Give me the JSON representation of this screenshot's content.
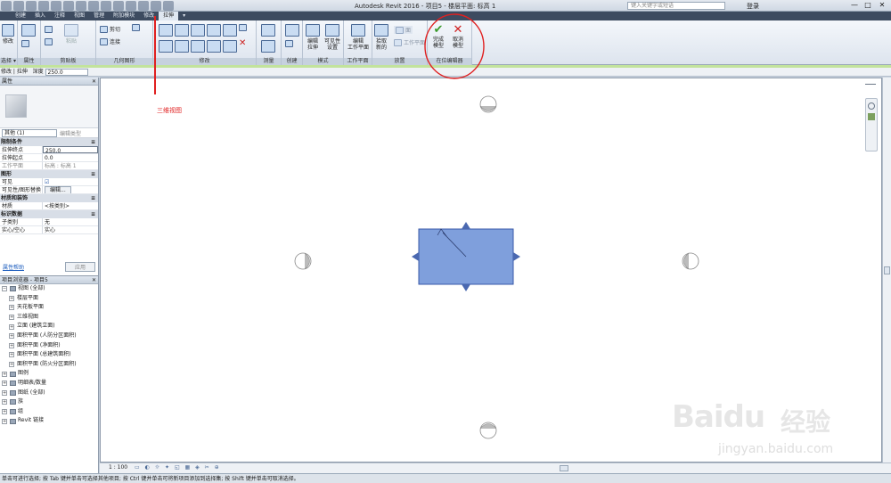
{
  "titlebar": {
    "title": "Autodesk Revit 2016 - 项目5 - 楼层平面: 标高 1",
    "search_placeholder": "键入关键字或短语",
    "login": "登录",
    "min": "—",
    "max": "□",
    "close": "✕"
  },
  "tabs": [
    "创建",
    "插入",
    "注释",
    "视图",
    "管理",
    "附加模块",
    "修改",
    "拉伸",
    "▾"
  ],
  "ribbon": {
    "modify_label": "修改",
    "select_label": "选择 ▾",
    "properties_label": "属性",
    "clipboard": {
      "paste": "粘贴",
      "label": "剪贴板"
    },
    "geometry": {
      "cut": "剪切",
      "join": "连接",
      "label": "几何图形"
    },
    "modify_panel_label": "修改",
    "measure_label": "测量",
    "create_label": "创建",
    "mode": {
      "edit_extrusion": "编辑\n拉伸",
      "visibility": "可见性\n设置",
      "label": "模式"
    },
    "workplane": {
      "edit": "编辑\n工作平面",
      "label": "工作平面"
    },
    "place": {
      "pick_new": "拾取\n新的",
      "face": "面",
      "workplane_btn": "工作平面",
      "label": "放置"
    },
    "inplace": {
      "finish": "完成\n模型",
      "cancel": "取消\n模型",
      "label": "在位编辑器"
    }
  },
  "optbar": {
    "context": "修改 | 拉伸",
    "depth_label": "深度",
    "depth_value": "250.0"
  },
  "properties": {
    "header": "属性",
    "type_selector": "其他 (1)",
    "edit_type": "编辑类型",
    "categories": {
      "constraints": "限制条件",
      "graphics": "图形",
      "materials": "材质和装饰",
      "identity": "标识数据"
    },
    "rows": {
      "extrusion_end_k": "拉伸终点",
      "extrusion_end_v": "250.0",
      "extrusion_start_k": "拉伸起点",
      "extrusion_start_v": "0.0",
      "workplane_k": "工作平面",
      "workplane_v": "标高 : 标高 1",
      "visible_k": "可见",
      "visible_v": "☑",
      "vis_override_k": "可见性/图形替换",
      "vis_override_v": "编辑...",
      "material_k": "材质",
      "material_v": "<按类别>",
      "subcategory_k": "子类别",
      "subcategory_v": "无",
      "solid_void_k": "实心/空心",
      "solid_void_v": "实心"
    },
    "help": "属性帮助",
    "apply": "应用"
  },
  "browser": {
    "header": "项目浏览器 - 项目5",
    "nodes": [
      {
        "label": "视图 (全部)",
        "level": 0
      },
      {
        "label": "楼层平面",
        "level": 1
      },
      {
        "label": "天花板平面",
        "level": 1
      },
      {
        "label": "三维视图",
        "level": 1
      },
      {
        "label": "立面 (建筑立面)",
        "level": 1
      },
      {
        "label": "面积平面 (人防分区面积)",
        "level": 1
      },
      {
        "label": "面积平面 (净面积)",
        "level": 1
      },
      {
        "label": "面积平面 (总建筑面积)",
        "level": 1
      },
      {
        "label": "面积平面 (防火分区面积)",
        "level": 1
      },
      {
        "label": "图例",
        "level": 0
      },
      {
        "label": "明细表/数量",
        "level": 0
      },
      {
        "label": "图纸 (全部)",
        "level": 0
      },
      {
        "label": "族",
        "level": 0
      },
      {
        "label": "组",
        "level": 0
      },
      {
        "label": "Revit 链接",
        "level": 0
      }
    ]
  },
  "viewbar": {
    "scale": "1 : 100"
  },
  "statusbar": {
    "text": "单击可进行选择; 按 Tab 键并单击可选择其他项目; 按 Ctrl 键并单击可将新项目添加到选择集; 按 Shift 键并单击可取消选择。"
  },
  "annotation": {
    "text": "三维视图"
  },
  "watermark": {
    "brand": "Baidu",
    "sub": "经验",
    "url": "jingyan.baidu.com"
  }
}
